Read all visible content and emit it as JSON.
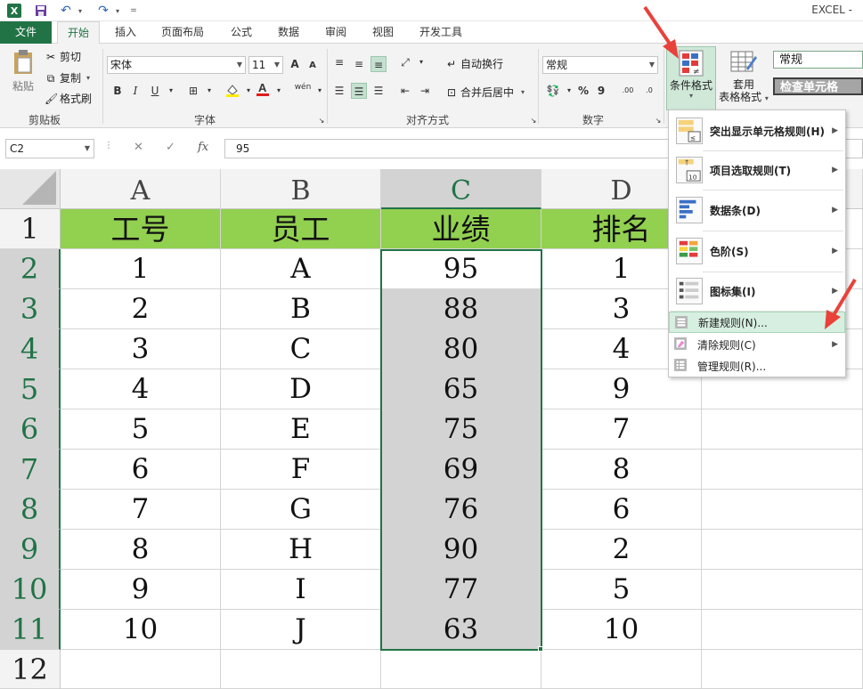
{
  "app": {
    "title": "EXCEL -",
    "icon_label": "X"
  },
  "tabs": [
    "文件",
    "开始",
    "插入",
    "页面布局",
    "公式",
    "数据",
    "审阅",
    "视图",
    "开发工具"
  ],
  "ribbon": {
    "paste_label": "粘贴",
    "cut_label": "剪切",
    "copy_label": "复制",
    "format_painter_label": "格式刷",
    "clipboard_group": "剪贴板",
    "font_name": "宋体",
    "font_size": "11",
    "font_group": "字体",
    "bold": "B",
    "italic": "I",
    "underline": "U",
    "phonetic": "wén",
    "grow_font": "A",
    "shrink_font": "A",
    "wrap_text_label": "自动换行",
    "merge_center_label": "合并后居中",
    "align_group": "对齐方式",
    "number_format": "常规",
    "percent": "%",
    "comma": "9",
    "number_group": "数字",
    "inc_decimal": ".00",
    "dec_decimal": ".0",
    "conditional_format_label": "条件格式",
    "table_format_label_1": "套用",
    "table_format_label_2": "表格格式",
    "style_normal": "常规",
    "style_check": "检查单元格"
  },
  "formula_bar": {
    "name_box": "C2",
    "value": "95",
    "fx": "fx"
  },
  "grid": {
    "columns": [
      "A",
      "B",
      "C",
      "D"
    ],
    "row_numbers": [
      "1",
      "2",
      "3",
      "4",
      "5",
      "6",
      "7",
      "8",
      "9",
      "10",
      "11",
      "12"
    ],
    "header": [
      "工号",
      "员工",
      "业绩",
      "排名"
    ],
    "rows": [
      [
        "1",
        "A",
        "95",
        "1"
      ],
      [
        "2",
        "B",
        "88",
        "3"
      ],
      [
        "3",
        "C",
        "80",
        "4"
      ],
      [
        "4",
        "D",
        "65",
        "9"
      ],
      [
        "5",
        "E",
        "75",
        "7"
      ],
      [
        "6",
        "F",
        "69",
        "8"
      ],
      [
        "7",
        "G",
        "76",
        "6"
      ],
      [
        "8",
        "H",
        "90",
        "2"
      ],
      [
        "9",
        "I",
        "77",
        "5"
      ],
      [
        "10",
        "J",
        "63",
        "10"
      ]
    ]
  },
  "menu": {
    "items": [
      {
        "label": "突出显示单元格规则(H)",
        "icon": "highlight-rules-icon"
      },
      {
        "label": "项目选取规则(T)",
        "icon": "top-bottom-rules-icon"
      },
      {
        "label": "数据条(D)",
        "icon": "data-bars-icon"
      },
      {
        "label": "色阶(S)",
        "icon": "color-scales-icon"
      },
      {
        "label": "图标集(I)",
        "icon": "icon-sets-icon"
      }
    ],
    "new_rule": "新建规则(N)...",
    "clear_rules": "清除规则(C)",
    "manage_rules": "管理规则(R)..."
  },
  "colors": {
    "accent": "#217346",
    "header_fill": "#92d050",
    "selection_fill": "#d3d3d3",
    "arrow": "#e8423a"
  }
}
